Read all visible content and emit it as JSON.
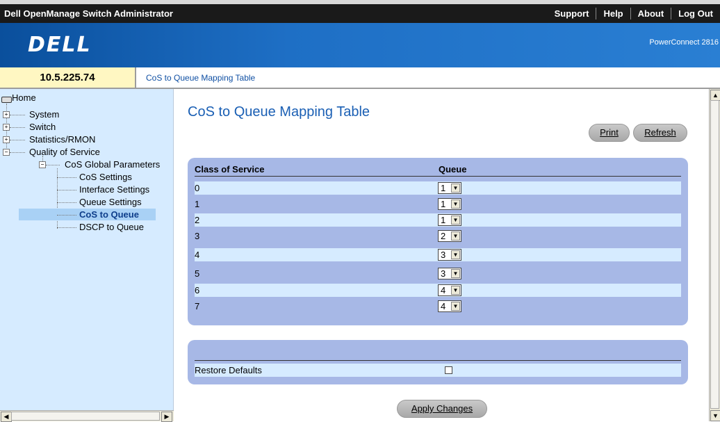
{
  "header": {
    "app_title": "Dell OpenManage Switch Administrator",
    "links": [
      "Support",
      "Help",
      "About",
      "Log Out"
    ]
  },
  "banner": {
    "logo": "DELL",
    "model": "PowerConnect 2816"
  },
  "ip_address": "10.5.225.74",
  "breadcrumb": "CoS to Queue Mapping Table",
  "tree": {
    "home": "Home",
    "system": "System",
    "switch": "Switch",
    "statistics": "Statistics/RMON",
    "qos": "Quality of Service",
    "cos_global": "CoS Global Parameters",
    "cos_settings": "CoS Settings",
    "interface_settings": "Interface Settings",
    "queue_settings": "Queue Settings",
    "cos_to_queue": "CoS to Queue",
    "dscp_to_queue": "DSCP to Queue"
  },
  "main": {
    "title": "CoS to Queue Mapping Table",
    "print_label": "Print",
    "refresh_label": "Refresh",
    "col_cos": "Class of Service",
    "col_queue": "Queue",
    "rows": [
      {
        "cos": "0",
        "queue": "1"
      },
      {
        "cos": "1",
        "queue": "1"
      },
      {
        "cos": "2",
        "queue": "1"
      },
      {
        "cos": "3",
        "queue": "2"
      },
      {
        "cos": "4",
        "queue": "3"
      },
      {
        "cos": "5",
        "queue": "3"
      },
      {
        "cos": "6",
        "queue": "4"
      },
      {
        "cos": "7",
        "queue": "4"
      }
    ],
    "restore_defaults_label": "Restore Defaults",
    "restore_defaults_checked": false,
    "apply_label": "Apply Changes"
  }
}
